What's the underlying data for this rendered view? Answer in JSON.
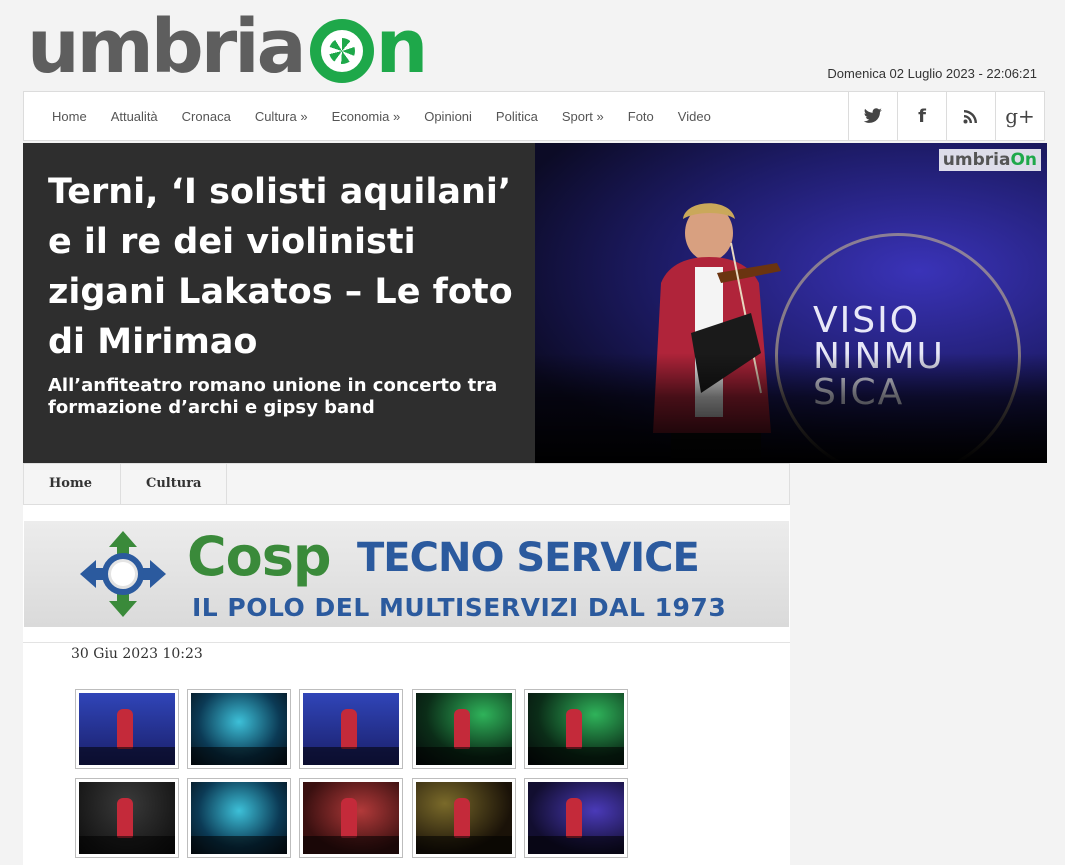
{
  "logo": {
    "part1": "umbria",
    "part2": "n"
  },
  "date": "Domenica 02 Luglio 2023 - 22:06:21",
  "nav": {
    "items": [
      "Home",
      "Attualità",
      "Cronaca",
      "Cultura »",
      "Economia »",
      "Opinioni",
      "Politica",
      "Sport »",
      "Foto",
      "Video"
    ],
    "social": [
      {
        "icon": "twitter-icon",
        "glyph": "🐦"
      },
      {
        "icon": "facebook-icon",
        "glyph": "f"
      },
      {
        "icon": "rss-icon",
        "glyph": "◉"
      },
      {
        "icon": "google-plus-icon",
        "glyph": "g+"
      }
    ]
  },
  "hero": {
    "title": "Terni, ‘I solisti aquilani’ e il re dei violinisti zigani Lakatos – Le foto di Mirimao",
    "subtitle": "All’anfiteatro romano unione in concerto tra formazione d’archi e gipsy band",
    "stage_text": "VISIO\nNINMU\nSICA",
    "watermark": {
      "part1": "umbria",
      "part2": "On"
    }
  },
  "breadcrumb": [
    "Home",
    "Cultura"
  ],
  "banner": {
    "brand": "Cosp",
    "name": "TECNO SERVICE",
    "tagline": "IL POLO DEL MULTISERVIZI DAL 1973"
  },
  "post": {
    "date": "30 Giu 2023 10:23"
  },
  "gallery": {
    "thumbs": [
      "t-blue",
      "t-teal",
      "t-blue",
      "t-green",
      "t-green",
      "t-dark",
      "t-teal",
      "t-warm",
      "t-gold",
      "t-purple"
    ]
  },
  "colors": {
    "brand_green": "#1ea84a",
    "logo_gray": "#5e5e5e",
    "cosp_green": "#3a8a3a",
    "cosp_blue": "#2b5a9e"
  }
}
